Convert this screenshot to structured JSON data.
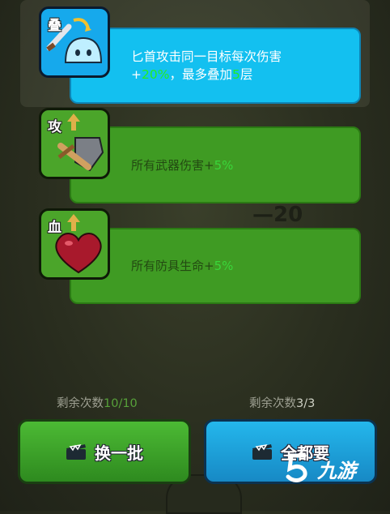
{
  "colors": {
    "blue_panel": "#13c0f0",
    "green_panel": "#3f9b23",
    "highlight_green": "#22ee22"
  },
  "cards": [
    {
      "tag": "叠",
      "icon": "dagger-slime-icon",
      "line1": "匕首攻击同一目标每次伤害",
      "line2_prefix": "+",
      "line2_value": "20%",
      "line2_mid": "，最多叠加",
      "line2_count": "5",
      "line2_suffix": "层",
      "selected": true
    },
    {
      "tag": "攻",
      "icon": "sword-shield-icon",
      "prefix": "所有武器伤害+",
      "value": "5%"
    },
    {
      "tag": "血",
      "icon": "heart-icon",
      "prefix": "所有防具生命+",
      "value": "5%"
    }
  ],
  "background_number": "—20",
  "counters": [
    {
      "label": "剩余次数",
      "value": "10/10"
    },
    {
      "label": "剩余次数",
      "value": "3/3"
    }
  ],
  "buttons": {
    "refresh": {
      "label": "换一批",
      "icon": "clapperboard-icon"
    },
    "take_all": {
      "label": "全都要",
      "icon": "clapperboard-icon"
    }
  },
  "watermark": {
    "text": "九游"
  }
}
